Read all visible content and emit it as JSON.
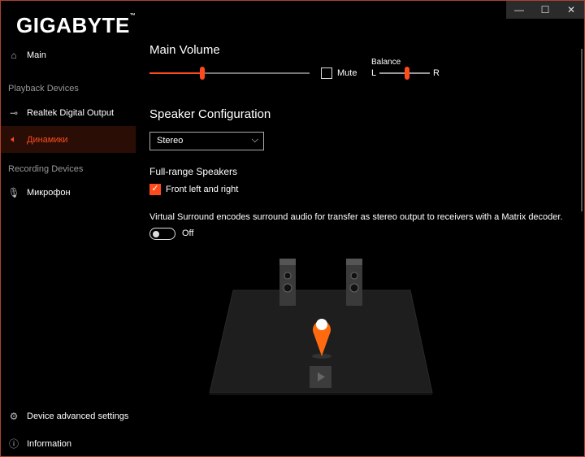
{
  "window": {
    "controls": {
      "minimize": "—",
      "maximize": "☐",
      "close": "✕"
    }
  },
  "brand": {
    "logo": "GIGABYTE",
    "tm": "™"
  },
  "sidebar": {
    "main": "Main",
    "playback_header": "Playback Devices",
    "playback": [
      {
        "label": "Realtek Digital Output"
      },
      {
        "label": "Динамики",
        "selected": true
      }
    ],
    "recording_header": "Recording Devices",
    "recording": [
      {
        "label": "Микрофон"
      }
    ],
    "advanced": "Device advanced settings",
    "info": "Information"
  },
  "main_volume": {
    "title": "Main Volume",
    "value_percent": 33,
    "mute_label": "Mute",
    "muted": false,
    "balance": {
      "label": "Balance",
      "left": "L",
      "right": "R",
      "value_percent": 55
    }
  },
  "speaker_config": {
    "title": "Speaker Configuration",
    "selected": "Stereo",
    "chevron": "⌵"
  },
  "full_range": {
    "title": "Full-range Speakers",
    "option": "Front left and right",
    "checked": true
  },
  "surround": {
    "description": "Virtual Surround encodes surround audio for transfer as stereo output to receivers with a Matrix decoder.",
    "state": "Off"
  },
  "colors": {
    "accent": "#ff4a1c"
  }
}
